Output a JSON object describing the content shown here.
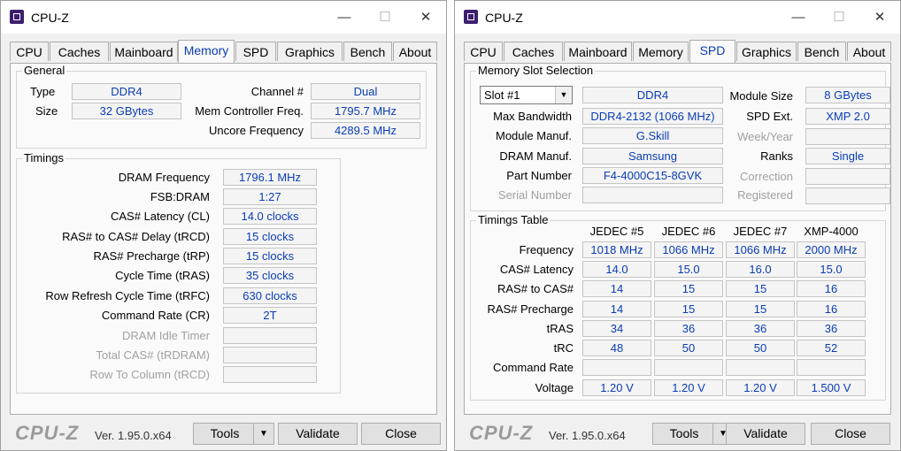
{
  "left": {
    "window": {
      "title": "CPU-Z"
    },
    "tabs": [
      "CPU",
      "Caches",
      "Mainboard",
      "Memory",
      "SPD",
      "Graphics",
      "Bench",
      "About"
    ],
    "general": {
      "title": "General",
      "type_label": "Type",
      "type_value": "DDR4",
      "size_label": "Size",
      "size_value": "32 GBytes",
      "channel_label": "Channel #",
      "channel_value": "Dual",
      "memctrl_label": "Mem Controller Freq.",
      "memctrl_value": "1795.7 MHz",
      "uncore_label": "Uncore Frequency",
      "uncore_value": "4289.5 MHz"
    },
    "timings": {
      "title": "Timings",
      "rows": [
        {
          "label": "DRAM Frequency",
          "value": "1796.1 MHz"
        },
        {
          "label": "FSB:DRAM",
          "value": "1:27"
        },
        {
          "label": "CAS# Latency (CL)",
          "value": "14.0 clocks"
        },
        {
          "label": "RAS# to CAS# Delay (tRCD)",
          "value": "15 clocks"
        },
        {
          "label": "RAS# Precharge (tRP)",
          "value": "15 clocks"
        },
        {
          "label": "Cycle Time (tRAS)",
          "value": "35 clocks"
        },
        {
          "label": "Row Refresh Cycle Time (tRFC)",
          "value": "630 clocks"
        },
        {
          "label": "Command Rate (CR)",
          "value": "2T"
        },
        {
          "label": "DRAM Idle Timer",
          "value": ""
        },
        {
          "label": "Total CAS# (tRDRAM)",
          "value": ""
        },
        {
          "label": "Row To Column (tRCD)",
          "value": ""
        }
      ]
    },
    "footer": {
      "logo": "CPU-Z",
      "version": "Ver. 1.95.0.x64",
      "tools": "Tools",
      "validate": "Validate",
      "close": "Close"
    }
  },
  "right": {
    "window": {
      "title": "CPU-Z"
    },
    "tabs": [
      "CPU",
      "Caches",
      "Mainboard",
      "Memory",
      "SPD",
      "Graphics",
      "Bench",
      "About"
    ],
    "slot": {
      "title": "Memory Slot Selection",
      "selected": "Slot #1",
      "type_value": "DDR4",
      "module_size_label": "Module Size",
      "module_size_value": "8 GBytes",
      "max_bw_label": "Max Bandwidth",
      "max_bw_value": "DDR4-2132 (1066 MHz)",
      "spd_ext_label": "SPD Ext.",
      "spd_ext_value": "XMP 2.0",
      "module_manuf_label": "Module Manuf.",
      "module_manuf_value": "G.Skill",
      "week_year_label": "Week/Year",
      "week_year_value": "",
      "dram_manuf_label": "DRAM Manuf.",
      "dram_manuf_value": "Samsung",
      "ranks_label": "Ranks",
      "ranks_value": "Single",
      "part_label": "Part Number",
      "part_value": "F4-4000C15-8GVK",
      "correction_label": "Correction",
      "correction_value": "",
      "serial_label": "Serial Number",
      "serial_value": "",
      "registered_label": "Registered",
      "registered_value": ""
    },
    "timings": {
      "title": "Timings Table",
      "columns": [
        "JEDEC #5",
        "JEDEC #6",
        "JEDEC #7",
        "XMP-4000"
      ],
      "rows": [
        {
          "label": "Frequency",
          "values": [
            "1018 MHz",
            "1066 MHz",
            "1066 MHz",
            "2000 MHz"
          ]
        },
        {
          "label": "CAS# Latency",
          "values": [
            "14.0",
            "15.0",
            "16.0",
            "15.0"
          ]
        },
        {
          "label": "RAS# to CAS#",
          "values": [
            "14",
            "15",
            "15",
            "16"
          ]
        },
        {
          "label": "RAS# Precharge",
          "values": [
            "14",
            "15",
            "15",
            "16"
          ]
        },
        {
          "label": "tRAS",
          "values": [
            "34",
            "36",
            "36",
            "36"
          ]
        },
        {
          "label": "tRC",
          "values": [
            "48",
            "50",
            "50",
            "52"
          ]
        },
        {
          "label": "Command Rate",
          "values": [
            "",
            "",
            "",
            ""
          ]
        },
        {
          "label": "Voltage",
          "values": [
            "1.20 V",
            "1.20 V",
            "1.20 V",
            "1.500 V"
          ]
        }
      ]
    },
    "footer": {
      "logo": "CPU-Z",
      "version": "Ver. 1.95.0.x64",
      "tools": "Tools",
      "validate": "Validate",
      "close": "Close"
    }
  }
}
